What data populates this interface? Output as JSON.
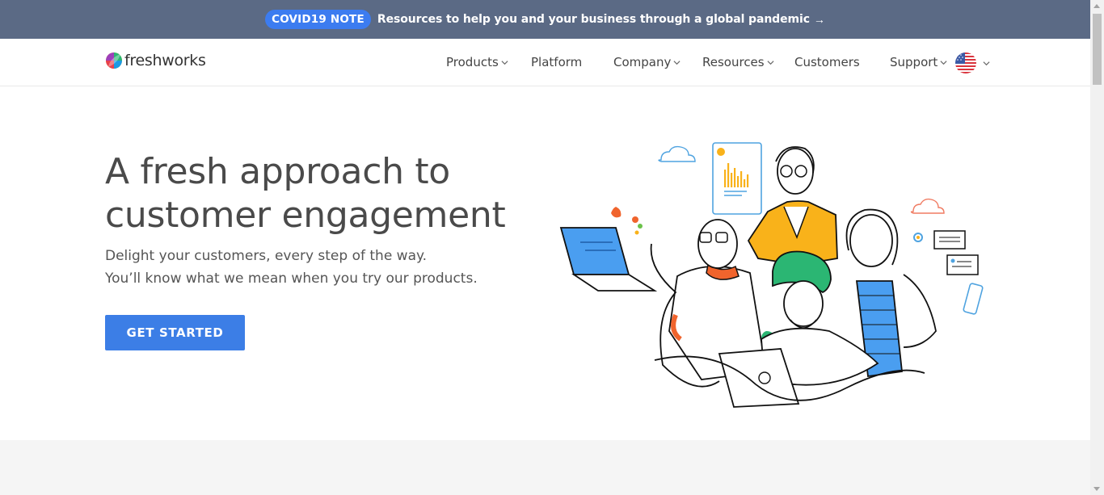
{
  "covid_banner": {
    "badge": "COVID19 NOTE",
    "text": "Resources to help you and your business through a global pandemic",
    "arrow": "→"
  },
  "nav": {
    "logo_text": "freshworks",
    "items": [
      {
        "label": "Products",
        "has_dropdown": true
      },
      {
        "label": "Platform",
        "has_dropdown": false
      },
      {
        "label": "Company",
        "has_dropdown": true
      },
      {
        "label": "Resources",
        "has_dropdown": true
      },
      {
        "label": "Customers",
        "has_dropdown": false
      },
      {
        "label": "Support",
        "has_dropdown": true
      }
    ],
    "language_icon": "us-flag-icon"
  },
  "hero": {
    "title_line1": "A fresh approach to",
    "title_line2": "customer engagement",
    "subtitle_line1": "Delight your customers, every step of the way.",
    "subtitle_line2": "You’ll know what we mean when you try our products.",
    "cta_label": "GET STARTED"
  },
  "colors": {
    "banner_bg": "#5b6a85",
    "badge_bg": "#3c7cf0",
    "cta_bg": "#3c7ee6",
    "title": "#4a4a4a"
  }
}
